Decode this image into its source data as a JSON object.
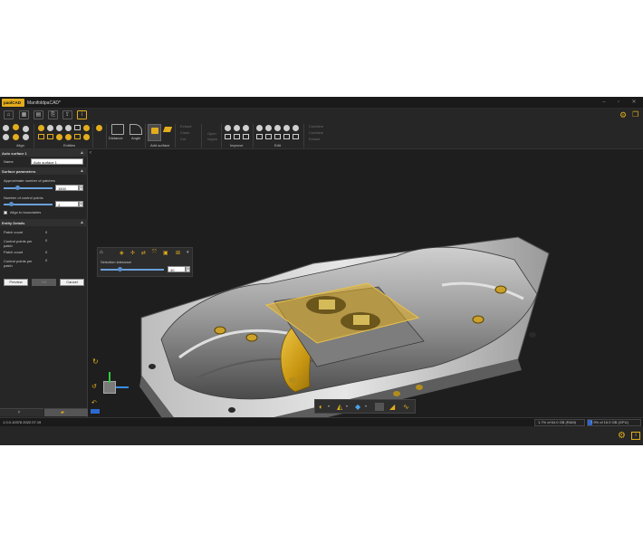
{
  "app": {
    "brand": "paolCAD",
    "title": "ManifoldpaCAD*"
  },
  "ribbon": {
    "groups": [
      "Align",
      "Entities",
      "Add surface",
      "Improve",
      "Edit"
    ],
    "buttons": {
      "distance": "Distance",
      "angle": "Angle"
    },
    "disabled_a": [
      "Extract",
      "Clean",
      "Cut"
    ],
    "disabled_b": [
      "Open",
      "region"
    ],
    "disabled_c": [
      "Combine",
      "Combine",
      "Extract"
    ]
  },
  "panel": {
    "title": "Auto surface 1",
    "name_label": "Name",
    "name_value": "Auto surface 1",
    "surface_params": "Surface parameters",
    "approx_label": "Approximate number of patches",
    "approx_value": "1500",
    "approx_level": 0.28,
    "ctrl_label": "Number of control points",
    "ctrl_value": "4",
    "ctrl_level": 0.15,
    "align_label": "Align to boundaries",
    "entity_details": "Entity Details",
    "details": [
      {
        "label": "Patch count",
        "value": "0"
      },
      {
        "label": "Control points per patch",
        "value": "0"
      },
      {
        "label": "Patch count",
        "value": "0"
      },
      {
        "label": "Control points per patch",
        "value": "0"
      }
    ],
    "btn_preview": "Preview",
    "btn_ok": "OK",
    "btn_cancel": "Cancel"
  },
  "subtool": {
    "label": "Selection tolerance",
    "value": "30",
    "level": 0.3
  },
  "status": {
    "version": "1.0.0.10378 2022.07.19",
    "ram": "1.7% of 64.0 GB (RAM)",
    "gpu": "7.9% of 16.0 GB (GPU)"
  },
  "colors": {
    "accent": "#e3ad1d",
    "background": "#1d1d1d"
  }
}
